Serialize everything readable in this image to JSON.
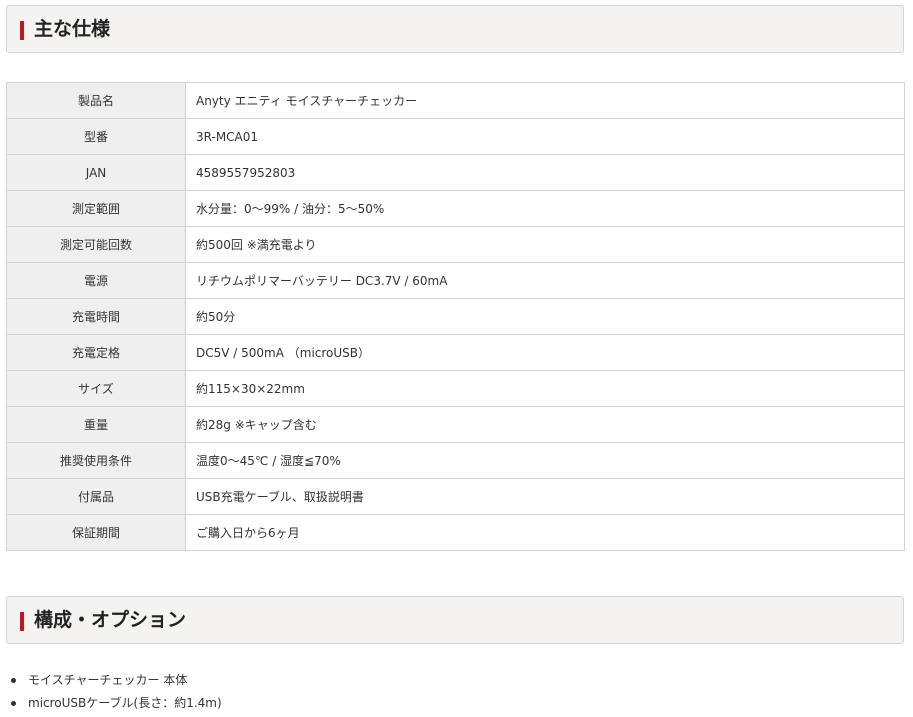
{
  "specs_section": {
    "title": "主な仕様",
    "rows": [
      {
        "label": "製品名",
        "value": "Anyty エニティ モイスチャーチェッカー"
      },
      {
        "label": "型番",
        "value": "3R-MCA01"
      },
      {
        "label": "JAN",
        "value": "4589557952803"
      },
      {
        "label": "測定範囲",
        "value": "水分量：0～99% / 油分：5～50%"
      },
      {
        "label": "測定可能回数",
        "value": "約500回 ※満充電より"
      },
      {
        "label": "電源",
        "value": "リチウムポリマーバッテリー DC3.7V / 60mA"
      },
      {
        "label": "充電時間",
        "value": "約50分"
      },
      {
        "label": "充電定格",
        "value": "DC5V / 500mA （microUSB）"
      },
      {
        "label": "サイズ",
        "value": "約115×30×22mm"
      },
      {
        "label": "重量",
        "value": "約28g ※キャップ含む"
      },
      {
        "label": "推奨使用条件",
        "value": "温度0～45℃ / 湿度≦70%"
      },
      {
        "label": "付属品",
        "value": "USB充電ケーブル、取扱説明書"
      },
      {
        "label": "保証期間",
        "value": "ご購入日から6ヶ月"
      }
    ]
  },
  "options_section": {
    "title": "構成・オプション",
    "items": [
      "モイスチャーチェッカー 本体",
      "microUSBケーブル(長さ：約1.4m)"
    ]
  },
  "colors": {
    "accent": "#c8161d",
    "header_background": "#f4f3f1",
    "label_cell_background": "#efefef",
    "border": "#d3d3d3"
  }
}
